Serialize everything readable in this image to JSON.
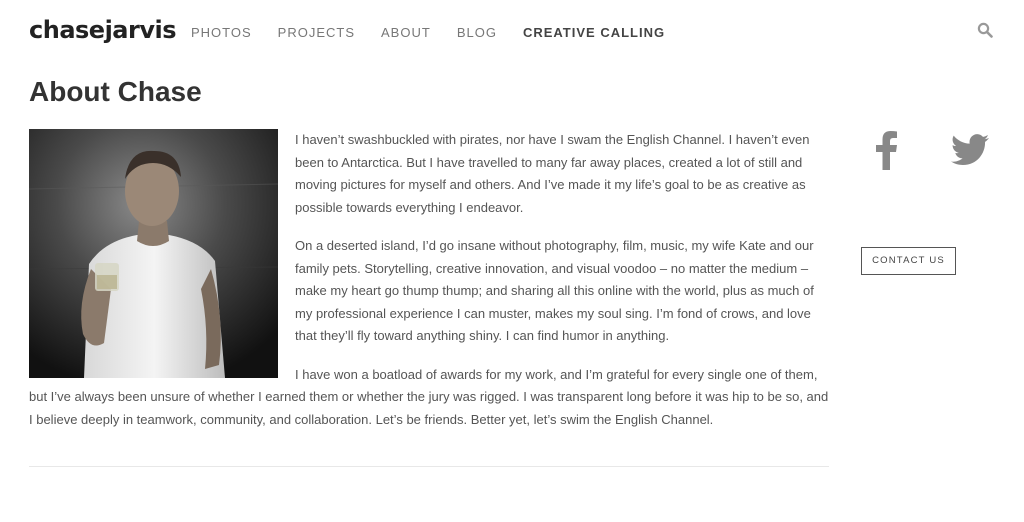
{
  "header": {
    "logo_text": "chasejarvis",
    "nav": [
      {
        "label": "PHOTOS"
      },
      {
        "label": "PROJECTS"
      },
      {
        "label": "ABOUT"
      },
      {
        "label": "BLOG"
      },
      {
        "label": "CREATIVE CALLING"
      }
    ],
    "search_icon": "search-icon"
  },
  "page": {
    "title": "About Chase"
  },
  "bio": {
    "paragraphs": [
      "I haven’t swashbuckled with pirates, nor have I swam the English Channel. I haven’t even been to Antarctica. But I have travelled to many far away places, created a lot of still and moving pictures for myself and others. And I’ve made it my life’s goal to be as creative as possible towards everything I endeavor.",
      "On a deserted island, I’d go insane without photography, film, music, my wife Kate and our family pets. Storytelling, creative innovation, and visual voodoo – no matter the medium – make my heart go thump thump; and sharing all this online with the world, plus as much of my professional experience I can muster, makes my soul sing. I’m fond of crows, and love that they’ll fly toward anything shiny. I can find humor in anything.",
      "I have won a boatload of awards for my work, and I’m grateful for every single one of them, but I’ve always been unsure of whether I earned them or whether the jury was rigged. I was transparent long before it was hip to be so, and I believe deeply in teamwork, community, and collaboration. Let’s be friends. Better yet, let’s swim the English Channel."
    ]
  },
  "sidebar": {
    "social_icons": [
      "facebook-icon",
      "twitter-icon"
    ],
    "contact_label": "CONTACT US"
  },
  "colors": {
    "text": "#555555",
    "heading": "#333333",
    "nav": "#777777",
    "icon_gray": "#888888"
  }
}
